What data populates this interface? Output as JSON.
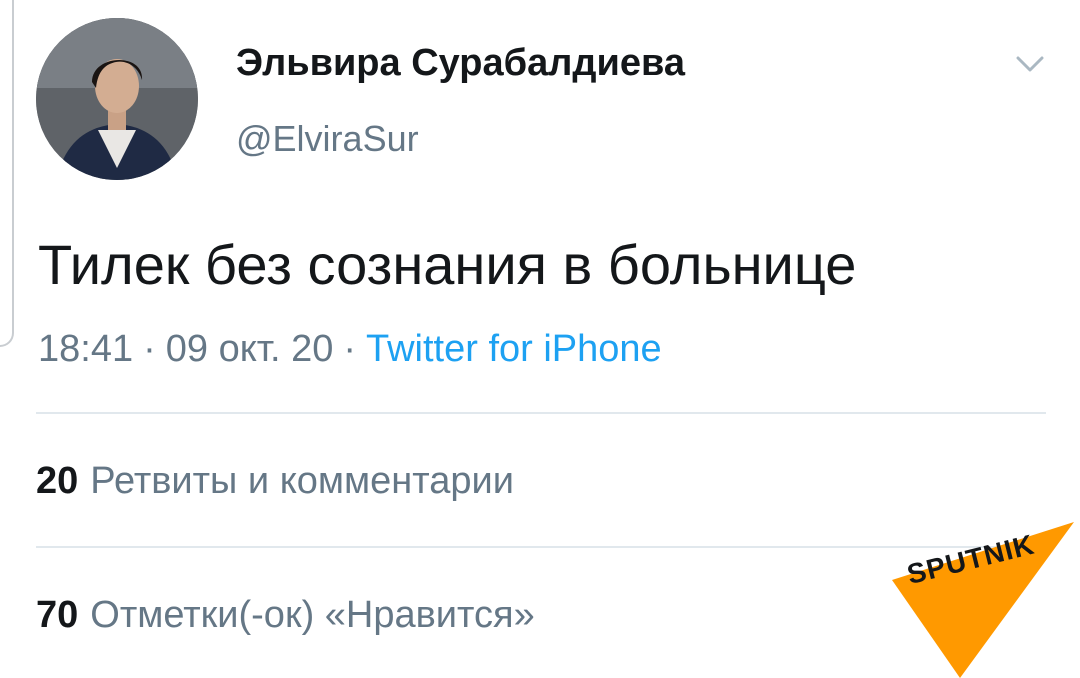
{
  "profile": {
    "display_name": "Эльвира Сурабалдиева",
    "handle": "@ElviraSur"
  },
  "tweet": {
    "text": "Тилек без сознания в больнице",
    "time": "18:41",
    "date": "09 окт. 20",
    "separator": "·",
    "source": "Twitter for iPhone"
  },
  "stats": {
    "retweets_count": "20",
    "retweets_label": "Ретвиты и комментарии",
    "likes_count": "70",
    "likes_label": "Отметки(-ок) «Нравится»"
  },
  "icons": {
    "menu": "chevron-down-icon"
  },
  "watermark": {
    "text": "SPUTNIK",
    "color": "#ff9900"
  },
  "colors": {
    "accent": "#1da1f2",
    "secondary_text": "#657786",
    "divider": "#e1e8ed"
  }
}
